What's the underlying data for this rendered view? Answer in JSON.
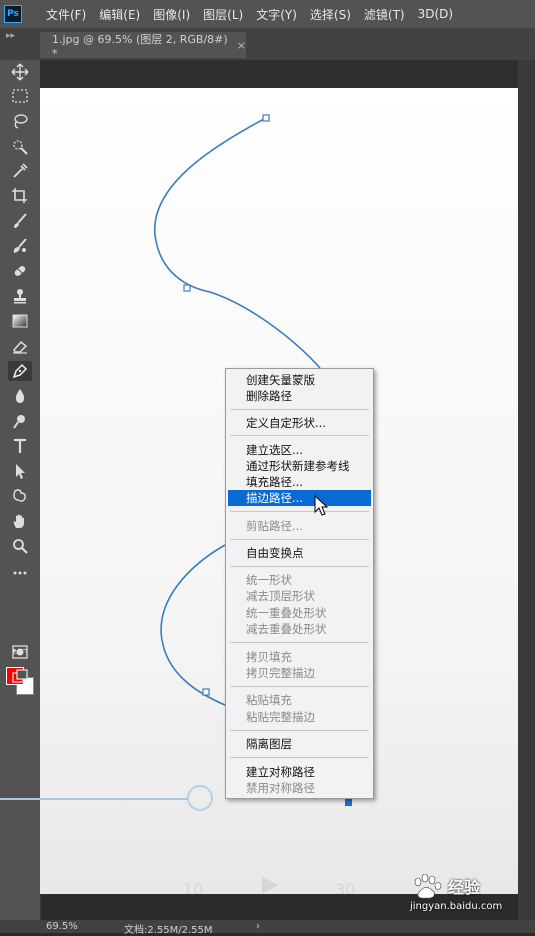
{
  "app": {
    "logo": "Ps"
  },
  "menubar": {
    "items": [
      "文件(F)",
      "编辑(E)",
      "图像(I)",
      "图层(L)",
      "文字(Y)",
      "选择(S)",
      "滤镜(T)",
      "3D(D)"
    ]
  },
  "document_tab": {
    "title": "1.jpg @ 69.5% (图层 2, RGB/8#) *",
    "close": "×"
  },
  "toolbar": {
    "collapse": "▸▸",
    "tools": [
      "move-icon",
      "marquee-icon",
      "lasso-icon",
      "quick-select-icon",
      "eyedropper-icon",
      "crop-icon",
      "brush-icon",
      "healing-icon",
      "patch-icon",
      "stamp-icon",
      "gradient-icon",
      "eraser-icon",
      "pen-icon",
      "blur-icon",
      "dodge-icon",
      "type-icon",
      "path-select-icon",
      "shape-icon",
      "hand-icon",
      "zoom-icon",
      "more-icon"
    ],
    "foreground_color": "#ff0000",
    "background_color": "#ffffff"
  },
  "context_menu": {
    "groups": [
      [
        {
          "label": "创建矢量蒙版",
          "enabled": true
        },
        {
          "label": "删除路径",
          "enabled": true
        }
      ],
      [
        {
          "label": "定义自定形状...",
          "enabled": true
        }
      ],
      [
        {
          "label": "建立选区...",
          "enabled": true
        },
        {
          "label": "通过形状新建参考线",
          "enabled": true
        },
        {
          "label": "填充路径...",
          "enabled": true
        },
        {
          "label": "描边路径...",
          "enabled": true,
          "highlighted": true
        }
      ],
      [
        {
          "label": "剪贴路径...",
          "enabled": false
        }
      ],
      [
        {
          "label": "自由变换点",
          "enabled": true
        }
      ],
      [
        {
          "label": "统一形状",
          "enabled": false
        },
        {
          "label": "减去顶层形状",
          "enabled": false
        },
        {
          "label": "统一重叠处形状",
          "enabled": false
        },
        {
          "label": "减去重叠处形状",
          "enabled": false
        }
      ],
      [
        {
          "label": "拷贝填充",
          "enabled": false
        },
        {
          "label": "拷贝完整描边",
          "enabled": false
        }
      ],
      [
        {
          "label": "粘贴填充",
          "enabled": false
        },
        {
          "label": "粘贴完整描边",
          "enabled": false
        }
      ],
      [
        {
          "label": "隔离图层",
          "enabled": true
        }
      ],
      [
        {
          "label": "建立对称路径",
          "enabled": true
        },
        {
          "label": "禁用对称路径",
          "enabled": false
        }
      ]
    ]
  },
  "video_overlay": {
    "rewind_label": "10",
    "forward_label": "30"
  },
  "statusbar": {
    "zoom": "69.5%",
    "doc": "文档:2.55M/2.55M",
    "arrow": "›"
  },
  "watermark": {
    "brand": "Bai",
    "brand_suffix": "经验",
    "url": "jingyan.baidu.com"
  },
  "colors": {
    "path_stroke": "#3b7dbf",
    "menu_highlight": "#0a6ad3",
    "anchor_selected": "#1a6fd1"
  }
}
